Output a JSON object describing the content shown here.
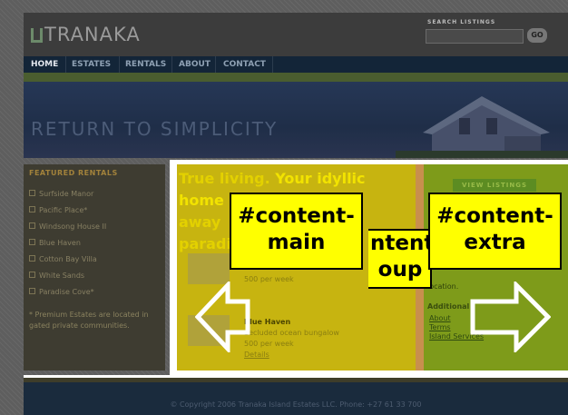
{
  "header": {
    "logo_text": "TRANAKA",
    "search_label": "SEARCH LISTINGS",
    "search_button": "GO",
    "nav": [
      "HOME",
      "ESTATES",
      "RENTALS",
      "ABOUT",
      "CONTACT"
    ],
    "tagline": "RETURN TO SIMPLICITY"
  },
  "sidebar": {
    "title": "FEATURED RENTALS",
    "items": [
      "Surfside Manor",
      "Pacific Place*",
      "Windsong House II",
      "Blue Haven",
      "Cotton Bay Villa",
      "White Sands",
      "Paradise Cove*"
    ],
    "note": "* Premium Estates are located in gated private communities."
  },
  "main": {
    "heading_line1a": "True living.",
    "heading_line1b": "Your idyllic home",
    "heading_line2": "away",
    "heading_line3": "paradi",
    "property1": {
      "price": "500 per week"
    },
    "property2": {
      "title": "Blue Haven",
      "desc": "Secluded ocean bungalow",
      "price": "500 per week",
      "link": "Details"
    }
  },
  "extra": {
    "view_button": "VIEW LISTINGS",
    "text1": "location.",
    "subhead": "Additional",
    "links": [
      "About",
      "Terms",
      "Island Services"
    ]
  },
  "annotations": {
    "content_main": [
      "#content-",
      "main"
    ],
    "content_group": [
      "ntent-",
      "oup"
    ],
    "content_extra": [
      "#content-",
      "extra"
    ]
  },
  "footer": {
    "copyright": "© Copyright 2006 Tranaka Island Estates LLC. Phone: +27 61 33 700"
  }
}
